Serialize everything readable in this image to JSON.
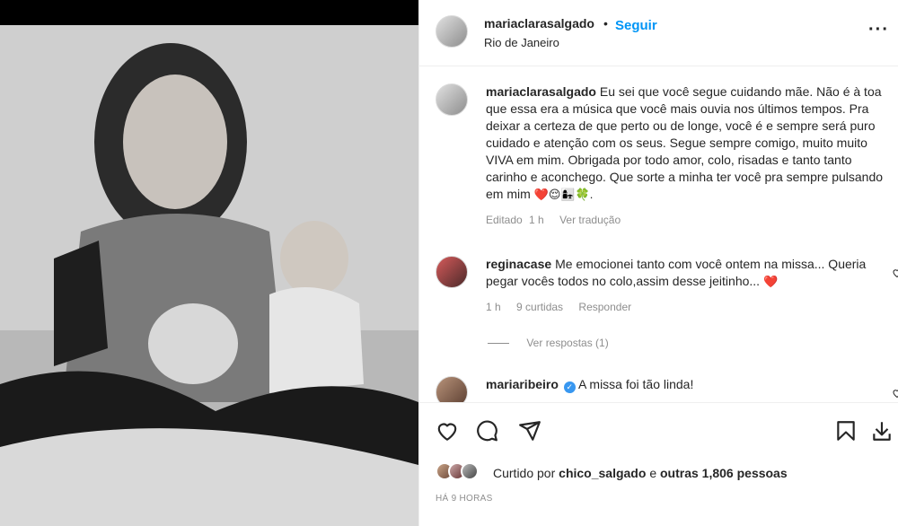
{
  "post": {
    "username": "mariaclarasalgado",
    "follow_label": "Seguir",
    "location": "Rio de Janeiro",
    "more_icon": "more-options-icon"
  },
  "caption": {
    "username": "mariaclarasalgado",
    "text": "Eu sei que você segue cuidando mãe. Não é à toa que essa era a música que você mais ouvia nos últimos tempos. Pra deixar a certeza de que perto ou de longe, você é e sempre será puro cuidado e atenção com os seus. Segue sempre comigo, muito muito VIVA em mim. Obrigada por todo amor, colo, risadas e tanto tanto carinho e aconchego. Que sorte a minha ter você pra sempre pulsando em mim",
    "emojis": "❤️😌👩‍👧🍀.",
    "edited": "Editado",
    "time": "1 h",
    "translate": "Ver tradução"
  },
  "comments": [
    {
      "username": "reginacase",
      "text": "Me emocionei tanto com você ontem na missa... Queria pegar vocês todos no colo,assim desse jeitinho...",
      "emoji": "❤️",
      "time": "1 h",
      "likes": "9 curtidas",
      "reply": "Responder",
      "view_replies": "Ver respostas (1)"
    },
    {
      "username": "mariaribeiro",
      "verified": true,
      "text": "A missa foi tão linda!"
    }
  ],
  "actions": {
    "like_icon": "heart-icon",
    "comment_icon": "comment-icon",
    "share_icon": "share-icon",
    "save_icon": "bookmark-icon",
    "download_icon": "download-icon"
  },
  "likes": {
    "prefix": "Curtido por",
    "user": "chico_salgado",
    "middle": "e",
    "others": "outras 1,806 pessoas"
  },
  "timestamp": "HÁ 9 HORAS",
  "colors": {
    "link": "#0095f6",
    "text": "#262626",
    "secondary": "#8e8e8e",
    "heart": "#ed4956"
  }
}
